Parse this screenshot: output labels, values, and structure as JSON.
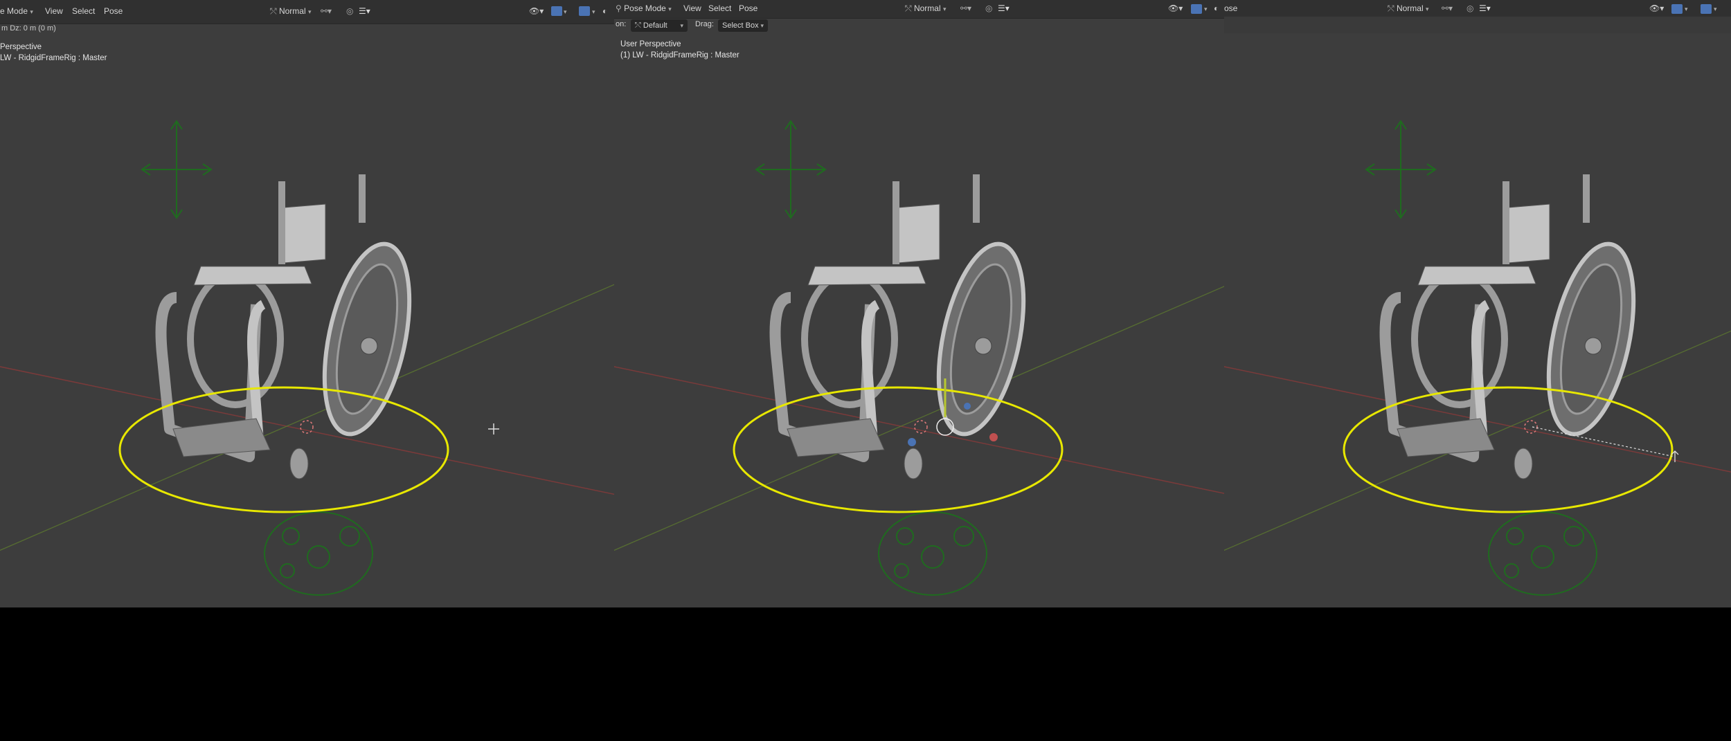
{
  "panel1": {
    "mode_label": "e Mode",
    "menu": [
      "View",
      "Select",
      "Pose"
    ],
    "shading": "Normal",
    "status": "m   Dz: 0 m (0 m)",
    "view_name": "Perspective",
    "object_name": "LW - RidgidFrameRig : Master"
  },
  "panel2": {
    "mode_label": "Pose Mode",
    "menu": [
      "View",
      "Select",
      "Pose"
    ],
    "shading": "Normal",
    "orientation_prefix": "on:",
    "orientation_value": "Default",
    "drag_label": "Drag:",
    "drag_value": "Select Box",
    "view_name": "User Perspective",
    "object_name": "(1) LW - RidgidFrameRig : Master"
  },
  "panel3": {
    "mode_label": "ose",
    "shading": "Normal"
  },
  "colors": {
    "viewport_bg": "#3d3d3d",
    "header_bg": "#303030",
    "selection_ring": "#e8e800",
    "bone_widget": "#1f6b1f",
    "axis_x": "#8a3a3a",
    "axis_y": "#5d7a2f",
    "active_icon": "#4a73b4"
  },
  "icons": [
    "mode-dropdown-icon",
    "view-transform-icon",
    "overlay-icon",
    "gizmo-icon",
    "shading-icon",
    "move-cursor-icon"
  ]
}
